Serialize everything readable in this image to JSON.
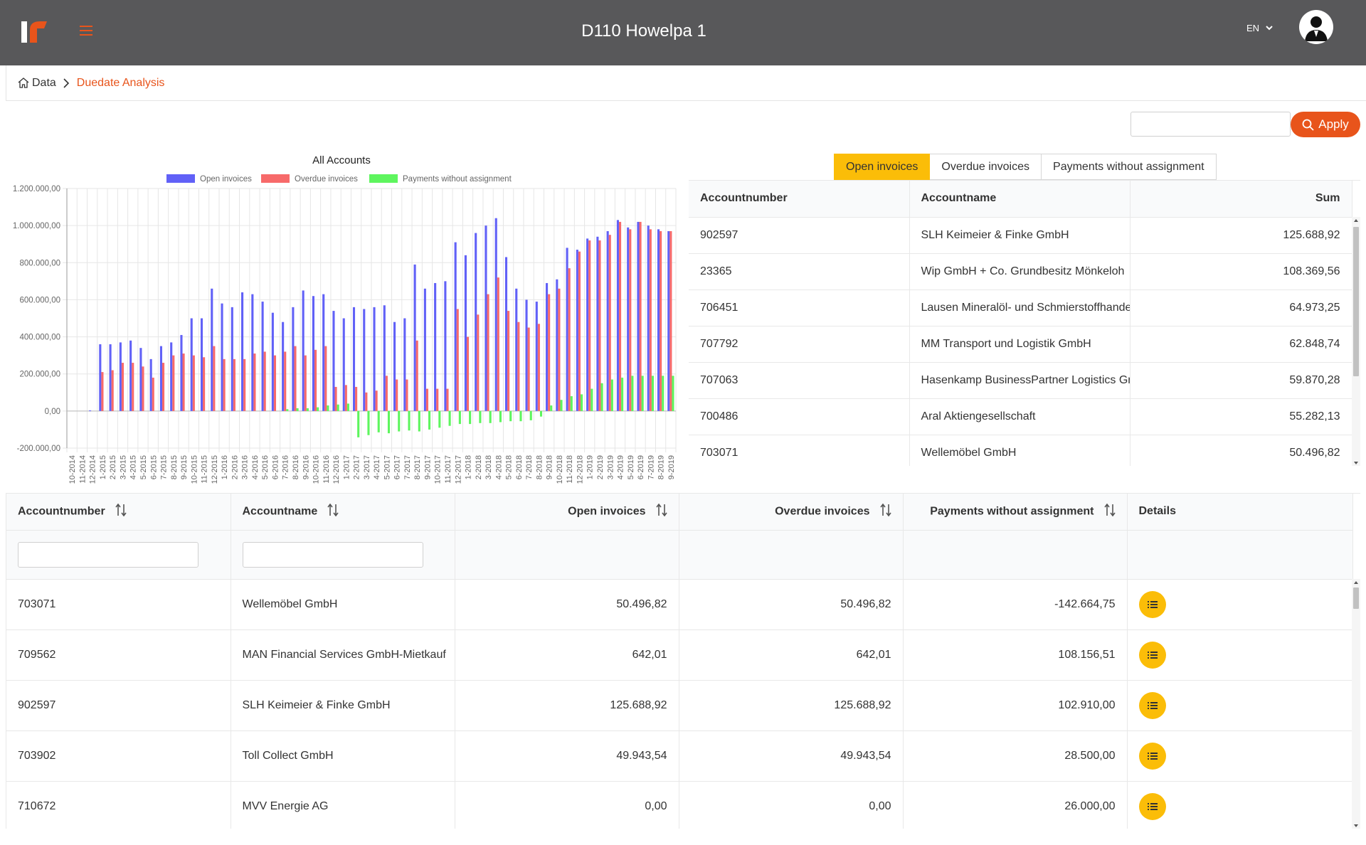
{
  "header": {
    "title": "D110 Howelpa 1",
    "language": "EN",
    "brand_color": "#e8541b"
  },
  "breadcrumb": {
    "home": "Data",
    "current": "Duedate Analysis"
  },
  "filter": {
    "value": "",
    "apply_label": "Apply"
  },
  "chart_data": {
    "type": "bar",
    "title": "All Accounts",
    "xlabel": "",
    "ylabel": "",
    "ylim": [
      -200000,
      1200000
    ],
    "yticks": [
      "1.200.000,00",
      "1.000.000,00",
      "800.000,00",
      "600.000,00",
      "400.000,00",
      "200.000,00",
      "0,00",
      "-200.000,00"
    ],
    "ytick_values": [
      1200000,
      1000000,
      800000,
      600000,
      400000,
      200000,
      0,
      -200000
    ],
    "grid": true,
    "legend_position": "top",
    "categories": [
      "10-2014",
      "11-2014",
      "12-2014",
      "1-2015",
      "2-2015",
      "3-2015",
      "4-2015",
      "5-2015",
      "6-2015",
      "7-2015",
      "8-2015",
      "9-2015",
      "10-2015",
      "11-2015",
      "12-2015",
      "1-2016",
      "2-2016",
      "3-2016",
      "4-2016",
      "5-2016",
      "6-2016",
      "7-2016",
      "8-2016",
      "9-2016",
      "10-2016",
      "11-2016",
      "12-2016",
      "1-2017",
      "2-2017",
      "3-2017",
      "4-2017",
      "5-2017",
      "6-2017",
      "7-2017",
      "8-2017",
      "9-2017",
      "10-2017",
      "11-2017",
      "12-2017",
      "1-2018",
      "2-2018",
      "3-2018",
      "4-2018",
      "5-2018",
      "6-2018",
      "7-2018",
      "8-2018",
      "9-2018",
      "10-2018",
      "11-2018",
      "12-2018",
      "1-2019",
      "2-2019",
      "3-2019",
      "4-2019",
      "5-2019",
      "6-2019",
      "7-2019",
      "8-2019",
      "9-2019"
    ],
    "series": [
      {
        "name": "Open invoices",
        "color": "#6161f7",
        "values": [
          0,
          0,
          3000,
          360000,
          360000,
          370000,
          380000,
          340000,
          280000,
          350000,
          370000,
          410000,
          500000,
          500000,
          660000,
          580000,
          560000,
          640000,
          630000,
          590000,
          530000,
          480000,
          560000,
          650000,
          620000,
          630000,
          540000,
          500000,
          560000,
          550000,
          560000,
          570000,
          480000,
          500000,
          790000,
          660000,
          690000,
          700000,
          910000,
          840000,
          960000,
          1000000,
          1040000,
          830000,
          660000,
          600000,
          590000,
          690000,
          710000,
          880000,
          870000,
          930000,
          940000,
          970000,
          1030000,
          990000,
          1020000,
          1000000,
          980000,
          970000
        ]
      },
      {
        "name": "Overdue invoices",
        "color": "#f76a6a",
        "values": [
          0,
          0,
          0,
          210000,
          220000,
          260000,
          260000,
          240000,
          180000,
          260000,
          300000,
          310000,
          300000,
          290000,
          350000,
          280000,
          280000,
          280000,
          310000,
          320000,
          300000,
          320000,
          350000,
          300000,
          330000,
          350000,
          130000,
          140000,
          130000,
          100000,
          110000,
          190000,
          170000,
          170000,
          380000,
          120000,
          120000,
          120000,
          550000,
          400000,
          520000,
          630000,
          720000,
          540000,
          480000,
          450000,
          470000,
          630000,
          660000,
          770000,
          860000,
          920000,
          920000,
          950000,
          1020000,
          980000,
          1020000,
          980000,
          970000,
          970000
        ]
      },
      {
        "name": "Payments without assignment",
        "color": "#5ef55e",
        "values": [
          0,
          0,
          0,
          0,
          0,
          0,
          0,
          0,
          0,
          0,
          0,
          0,
          0,
          0,
          0,
          0,
          0,
          0,
          0,
          0,
          0,
          10000,
          15000,
          15000,
          20000,
          30000,
          35000,
          40000,
          -142000,
          -130000,
          -115000,
          -120000,
          -110000,
          -105000,
          -110000,
          -100000,
          -90000,
          -80000,
          -70000,
          -70000,
          -65000,
          -65000,
          -60000,
          -55000,
          -55000,
          -50000,
          -30000,
          30000,
          60000,
          80000,
          90000,
          120000,
          150000,
          170000,
          180000,
          190000,
          190000,
          190000,
          190000,
          190000
        ]
      }
    ]
  },
  "tabs": [
    {
      "label": "Open invoices",
      "active": true
    },
    {
      "label": "Overdue invoices",
      "active": false
    },
    {
      "label": "Payments without assignment",
      "active": false
    }
  ],
  "summary_table": {
    "columns": [
      "Accountnumber",
      "Accountname",
      "Sum"
    ],
    "rows": [
      [
        "902597",
        "SLH Keimeier & Finke GmbH",
        "125.688,92"
      ],
      [
        "23365",
        "Wip GmbH + Co. Grundbesitz Mönkeloh",
        "108.369,56"
      ],
      [
        "706451",
        "Lausen Mineralöl- und Schmierstoffhandel",
        "64.973,25"
      ],
      [
        "707792",
        "MM Transport und Logistik GmbH",
        "62.848,74"
      ],
      [
        "707063",
        "Hasenkamp BusinessPartner Logistics GmbH",
        "59.870,28"
      ],
      [
        "700486",
        "Aral Aktiengesellschaft",
        "55.282,13"
      ],
      [
        "703071",
        "Wellemöbel GmbH",
        "50.496,82"
      ]
    ]
  },
  "main_table": {
    "columns": [
      "Accountnumber",
      "Accountname",
      "Open invoices",
      "Overdue invoices",
      "Payments without assignment",
      "Details"
    ],
    "filters": {
      "accountnumber": "",
      "accountname": ""
    },
    "rows": [
      [
        "703071",
        "Wellemöbel GmbH",
        "50.496,82",
        "50.496,82",
        "-142.664,75"
      ],
      [
        "709562",
        "MAN Financial Services GmbH-Mietkauf",
        "642,01",
        "642,01",
        "108.156,51"
      ],
      [
        "902597",
        "SLH Keimeier & Finke GmbH",
        "125.688,92",
        "125.688,92",
        "102.910,00"
      ],
      [
        "703902",
        "Toll Collect GmbH",
        "49.943,54",
        "49.943,54",
        "28.500,00"
      ],
      [
        "710672",
        "MVV Energie AG",
        "0,00",
        "0,00",
        "26.000,00"
      ]
    ]
  }
}
